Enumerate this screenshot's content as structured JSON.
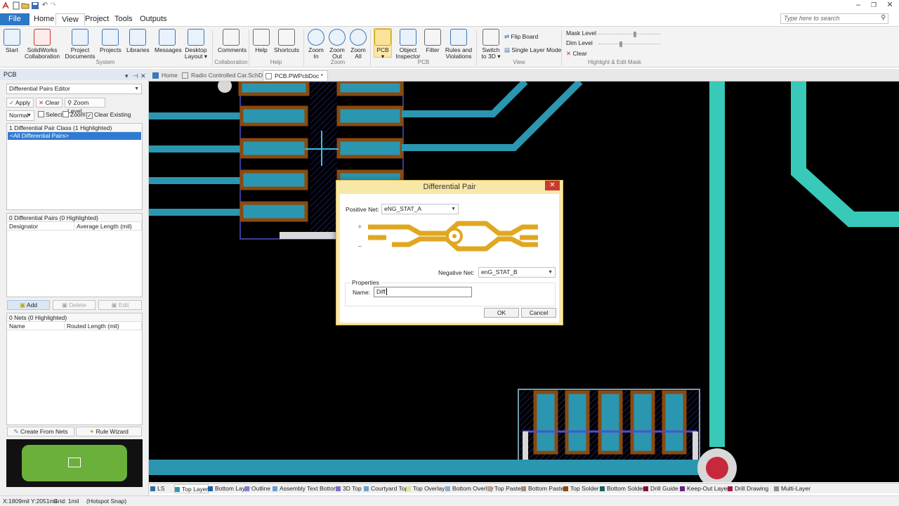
{
  "titlebar": {
    "win_min": "–",
    "win_restore": "❐",
    "win_close": "✕"
  },
  "menu": {
    "file": "File",
    "home": "Home",
    "view": "View",
    "project": "Project",
    "tools": "Tools",
    "outputs": "Outputs"
  },
  "search": {
    "placeholder": "Type here to search"
  },
  "ribbon": {
    "start": "Start",
    "solidworks": [
      "SolidWorks",
      "Collaboration"
    ],
    "project_documents": [
      "Project",
      "Documents"
    ],
    "projects": "Projects",
    "libraries": "Libraries",
    "messages": "Messages",
    "desktop_layout": [
      "Desktop",
      "Layout ▾"
    ],
    "comments": "Comments",
    "help": "Help",
    "shortcuts": "Shortcuts",
    "zoom_in": [
      "Zoom",
      "In"
    ],
    "zoom_out": [
      "Zoom",
      "Out"
    ],
    "zoom_all": [
      "Zoom",
      "All"
    ],
    "pcb": [
      "PCB",
      "▾"
    ],
    "object_inspector": [
      "Object",
      "Inspector"
    ],
    "filter": "Filter",
    "rules": [
      "Rules and",
      "Violations"
    ],
    "switch_3d": [
      "Switch",
      "to 3D ▾"
    ],
    "flip_board": "Flip Board",
    "single_layer": "Single Layer Mode",
    "mask_level": "Mask Level",
    "dim_level": "Dim Level",
    "clear": "Clear",
    "groups": {
      "system": "System",
      "collaboration": "Collaboration",
      "help": "Help",
      "zoom": "Zoom",
      "pcb": "PCB",
      "view": "View",
      "highlight": "Highlight & Edit Mask"
    }
  },
  "panel": {
    "title": "PCB",
    "mode": "Differential Pairs Editor",
    "apply": "Apply",
    "clear": "Clear",
    "zoom_level": "Zoom Level...",
    "normal": "Normal",
    "select": "Select",
    "zoom": "Zoom",
    "clear_existing": "Clear Existing",
    "class_header": "1 Differential Pair Class (1 Highlighted)",
    "class_item": "<All Differential Pairs>",
    "pairs_header": "0 Differential Pairs (0 Highlighted)",
    "col_designator": "Designator",
    "col_avg_length": "Average Length (mil)",
    "add": "Add",
    "delete": "Delete",
    "edit": "Edit",
    "nets_header": "0 Nets (0 Highlighted)",
    "col_name": "Name",
    "col_routed": "Routed Length (mil)",
    "create_from_nets": "Create From Nets",
    "rule_wizard": "Rule Wizard"
  },
  "tabs": {
    "home": "Home",
    "sch": "Radio Controlled Car.SchDoc",
    "pcb": "PCB.PWPcbDoc *"
  },
  "layers": [
    "LS",
    "Top Layer",
    "Bottom Layer",
    "Outline",
    "Assembly Text Bottom",
    "3D Top",
    "Courtyard Top",
    "Top Overlay",
    "Bottom Overlay",
    "Top Paste",
    "Bottom Paste",
    "Top Solder",
    "Bottom Solder",
    "Drill Guide",
    "Keep-Out Layer",
    "Drill Drawing",
    "Multi-Layer"
  ],
  "layer_colors": [
    "#2a6ea6",
    "#2b96b0",
    "#1f5fa3",
    "#7f7fd0",
    "#6fa0d0",
    "#8070c0",
    "#70a0c8",
    "#e0e0a0",
    "#90b0c8",
    "#c0a090",
    "#b08878",
    "#8a4a10",
    "#1a6060",
    "#8a1030",
    "#6a2080",
    "#a01850",
    "#909090"
  ],
  "status": {
    "coords": "X:1809mil Y:2051mil",
    "grid": "Grid: 1mil",
    "snap": "(Hotspot Snap)"
  },
  "dialog": {
    "title": "Differential Pair",
    "positive_label": "Positive Net:",
    "positive_value": "eNG_STAT_A",
    "negative_label": "Negative Net:",
    "negative_value": "enG_STAT_B",
    "plus": "+",
    "minus": "−",
    "properties": "Properties",
    "name_label": "Name:",
    "name_value": "Diff",
    "ok": "OK",
    "cancel": "Cancel"
  },
  "colors": {
    "trace": "#2b96b0",
    "pad_fill": "#2b96b0",
    "pad_ring": "#8a4a10",
    "board_edge": "#4f4fd0",
    "highlight_trace": "#39c9b8"
  }
}
